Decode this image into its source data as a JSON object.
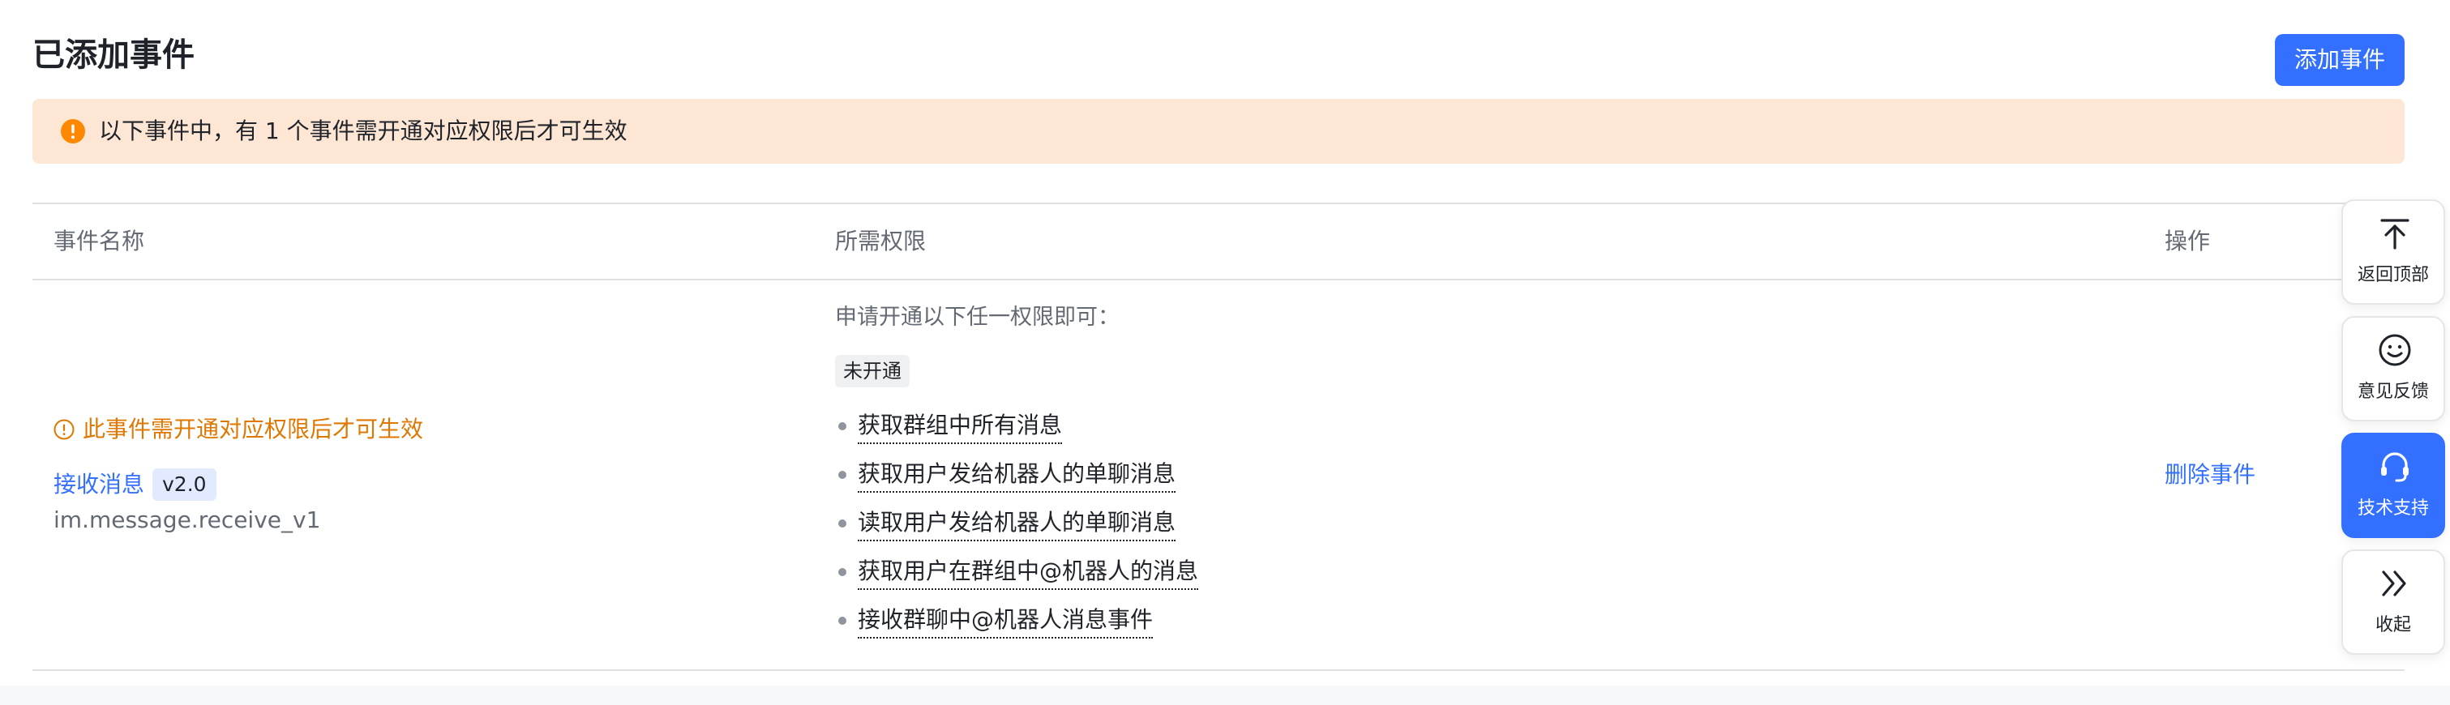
{
  "page": {
    "title": "已添加事件",
    "add_button": "添加事件"
  },
  "alert": {
    "text": "以下事件中，有 1 个事件需开通对应权限后才可生效",
    "color": "#fde7d4"
  },
  "table": {
    "headers": {
      "name": "事件名称",
      "permissions": "所需权限",
      "actions": "操作"
    },
    "rows": [
      {
        "warning": "此事件需开通对应权限后才可生效",
        "event_name": "接收消息",
        "version": "v2.0",
        "event_key": "im.message.receive_v1",
        "permission_hint": "申请开通以下任一权限即可：",
        "status": "未开通",
        "permissions": [
          "获取群组中所有消息",
          "获取用户发给机器人的单聊消息",
          "读取用户发给机器人的单聊消息",
          "获取用户在群组中@机器人的消息",
          "接收群聊中@机器人消息事件"
        ],
        "action": "删除事件"
      }
    ]
  },
  "float_toolbar": [
    {
      "label": "返回顶部",
      "icon": "arrow-up-to-top-icon"
    },
    {
      "label": "意见反馈",
      "icon": "smiley-icon"
    },
    {
      "label": "技术支持",
      "icon": "headset-icon",
      "active": true
    },
    {
      "label": "收起",
      "icon": "double-chevron-right-icon"
    }
  ],
  "colors": {
    "accent": "#3370ff",
    "warning": "#de7802",
    "alert_background": "#fde7d4"
  }
}
